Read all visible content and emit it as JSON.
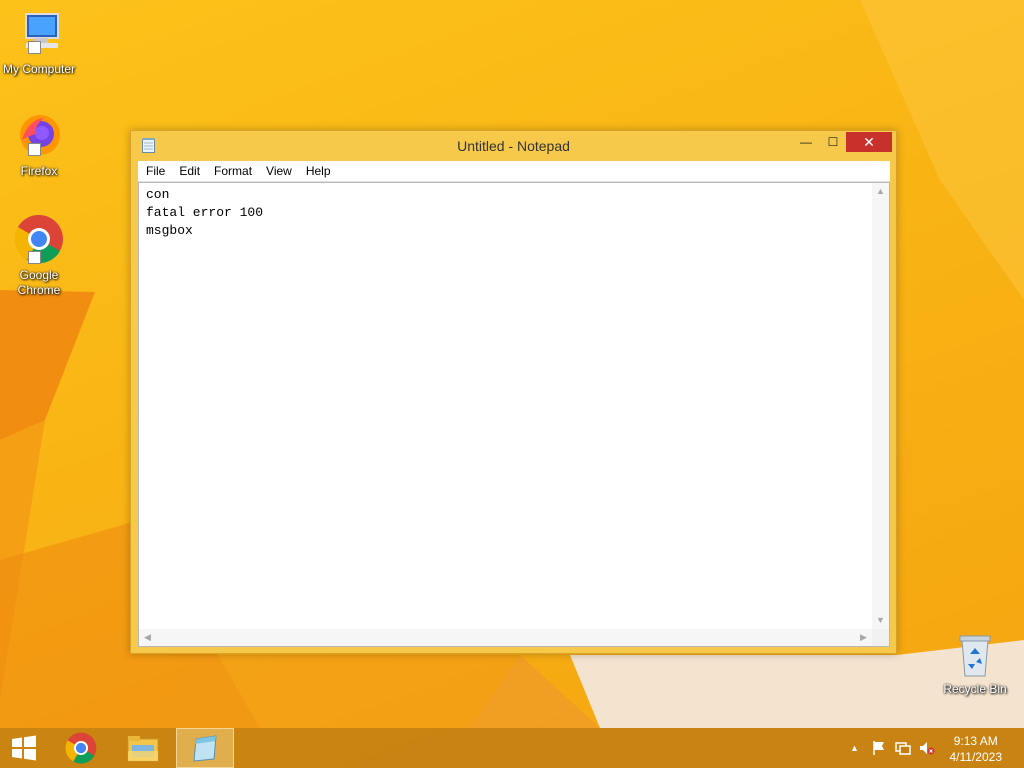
{
  "desktop": {
    "icons": [
      {
        "label": "My Computer",
        "icon": "computer-icon"
      },
      {
        "label": "Firefox",
        "icon": "firefox-icon"
      },
      {
        "label": "Google Chrome",
        "icon": "chrome-icon"
      },
      {
        "label": "Recycle Bin",
        "icon": "recycle-bin-icon"
      }
    ]
  },
  "window": {
    "title": "Untitled - Notepad",
    "controls": {
      "minimize": "—",
      "maximize": "☐",
      "close": "✕"
    },
    "menu": [
      "File",
      "Edit",
      "Format",
      "View",
      "Help"
    ],
    "content": "con\nfatal error 100\nmsgbox"
  },
  "taskbar": {
    "items": [
      "start-icon",
      "chrome-icon",
      "file-explorer-icon",
      "notepad-icon"
    ],
    "active": "notepad",
    "tray": {
      "time": "9:13 AM",
      "date": "4/11/2023"
    }
  },
  "colors": {
    "wallpaper": "#f9b414",
    "window_frame": "#f7c94a",
    "close_button": "#c7302b",
    "taskbar": "#c48012"
  }
}
